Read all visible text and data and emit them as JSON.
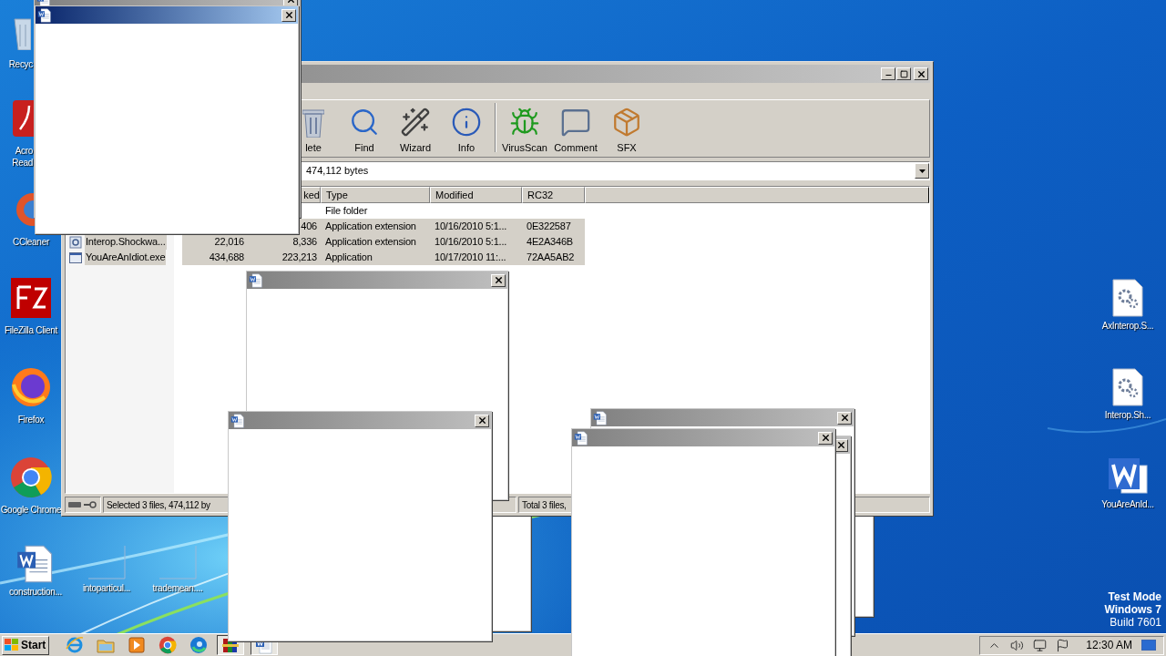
{
  "desktop_icons_left": [
    {
      "label": "Recyc",
      "kind": "recycle"
    },
    {
      "label": "Acro Read",
      "kind": "acrobat"
    },
    {
      "label": "CCleaner",
      "kind": "ccleaner"
    },
    {
      "label": "FileZilla Client",
      "kind": "filezilla"
    },
    {
      "label": "Firefox",
      "kind": "firefox"
    },
    {
      "label": "Google Chrome",
      "kind": "chrome"
    }
  ],
  "desktop_icons_bottom": [
    {
      "label": "construction...",
      "kind": "word-doc"
    },
    {
      "label": "intoparticul...",
      "kind": "blank"
    },
    {
      "label": "trademean....",
      "kind": "blank"
    }
  ],
  "desktop_icons_right": [
    {
      "label": "AxInterop.S...",
      "kind": "settings-file"
    },
    {
      "label": "Interop.Sh...",
      "kind": "settings-file"
    },
    {
      "label": "YouAreAnId...",
      "kind": "word"
    }
  ],
  "archiver": {
    "toolbar": [
      {
        "label": "lete",
        "kind": "delete"
      },
      {
        "label": "Find",
        "kind": "find"
      },
      {
        "label": "Wizard",
        "kind": "wizard"
      },
      {
        "label": "Info",
        "kind": "info"
      },
      {
        "label": "VirusScan",
        "kind": "virusscan"
      },
      {
        "label": "Comment",
        "kind": "comment"
      },
      {
        "label": "SFX",
        "kind": "sfx"
      }
    ],
    "address": "474,112 bytes",
    "columns": [
      "ked",
      "Type",
      "Modified",
      "RC32"
    ],
    "rows": [
      {
        "type": "File folder",
        "selected": false
      },
      {
        "packed": "406",
        "type": "Application extension",
        "modified": "10/16/2010 5:1...",
        "crc": "0E322587",
        "selected": true
      },
      {
        "name": "Interop.Shockwa...",
        "kind": "dll",
        "size": "22,016",
        "packed": "8,336",
        "type": "Application extension",
        "modified": "10/16/2010 5:1...",
        "crc": "4E2A346B",
        "selected": true
      },
      {
        "name": "YouAreAnIdiot.exe",
        "kind": "exe",
        "size": "434,688",
        "packed": "223,213",
        "type": "Application",
        "modified": "10/17/2010 11:...",
        "crc": "72AA5AB2",
        "selected": true
      }
    ],
    "status_left": "Selected 3 files, 474,112 by",
    "status_right": "Total 3 files,"
  },
  "popups": [
    {
      "active": false
    },
    {
      "active": true
    },
    {
      "active": false
    },
    {
      "active": false
    },
    {
      "active": false
    },
    {
      "active": false
    },
    {
      "active": false
    }
  ],
  "system_notice": [
    "Test Mode",
    "Windows 7",
    "Build 7601"
  ],
  "taskbar": {
    "start": "Start",
    "items": [
      {
        "kind": "ie",
        "active": false
      },
      {
        "kind": "explorer",
        "active": false
      },
      {
        "kind": "media",
        "active": false
      },
      {
        "kind": "chrome",
        "active": false
      },
      {
        "kind": "edge",
        "active": false
      },
      {
        "kind": "winrar",
        "active": true
      },
      {
        "kind": "word",
        "active": true
      }
    ],
    "clock": "12:30 AM"
  }
}
